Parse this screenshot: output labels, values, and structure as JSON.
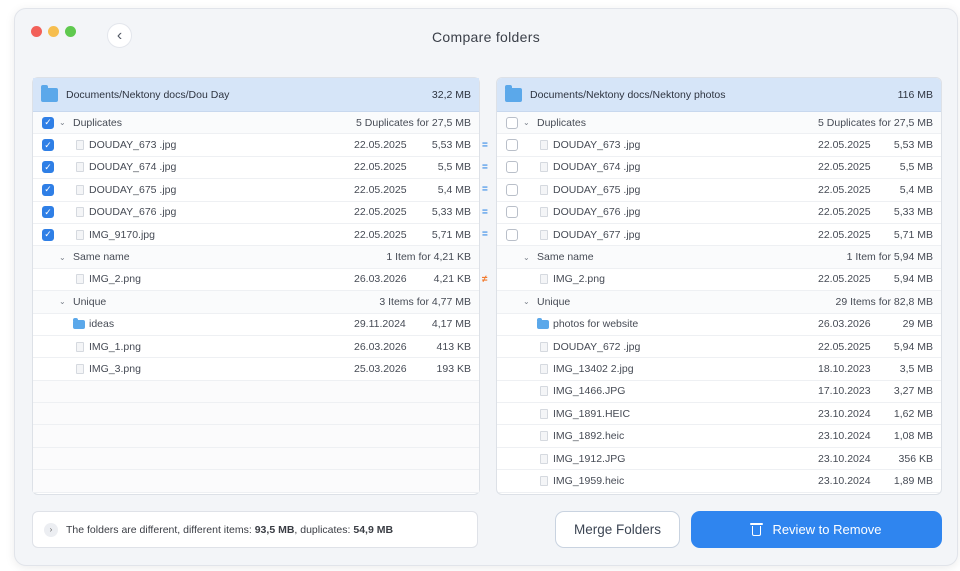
{
  "window": {
    "title": "Compare folders"
  },
  "left": {
    "path": "Documents/Nektony docs/Dou Day",
    "size": "32,2 MB",
    "groups": {
      "duplicates": {
        "label": "Duplicates",
        "summary": "5 Duplicates for 27,5 MB",
        "checked": true
      },
      "same_name": {
        "label": "Same name",
        "summary": "1 Item for 4,21 KB"
      },
      "unique": {
        "label": "Unique",
        "summary": "3 Items for 4,77 MB"
      }
    },
    "duplicates": [
      {
        "name": "DOUDAY_673 .jpg",
        "date": "22.05.2025",
        "size": "5,53 MB",
        "checked": true,
        "mark": "="
      },
      {
        "name": "DOUDAY_674 .jpg",
        "date": "22.05.2025",
        "size": "5,5 MB",
        "checked": true,
        "mark": "="
      },
      {
        "name": "DOUDAY_675 .jpg",
        "date": "22.05.2025",
        "size": "5,4 MB",
        "checked": true,
        "mark": "="
      },
      {
        "name": "DOUDAY_676 .jpg",
        "date": "22.05.2025",
        "size": "5,33 MB",
        "checked": true,
        "mark": "="
      },
      {
        "name": "IMG_9170.jpg",
        "date": "22.05.2025",
        "size": "5,71 MB",
        "checked": true,
        "mark": "="
      }
    ],
    "same_name": [
      {
        "name": "IMG_2.png",
        "date": "26.03.2026",
        "size": "4,21 KB",
        "mark": "≠"
      }
    ],
    "unique": [
      {
        "name": "ideas",
        "date": "29.11.2024",
        "size": "4,17 MB",
        "folder": true
      },
      {
        "name": "IMG_1.png",
        "date": "26.03.2026",
        "size": "413 KB"
      },
      {
        "name": "IMG_3.png",
        "date": "25.03.2026",
        "size": "193 KB"
      }
    ]
  },
  "right": {
    "path": "Documents/Nektony docs/Nektony photos",
    "size": "116 MB",
    "groups": {
      "duplicates": {
        "label": "Duplicates",
        "summary": "5 Duplicates for 27,5 MB",
        "checked": false
      },
      "same_name": {
        "label": "Same name",
        "summary": "1 Item for 5,94 MB"
      },
      "unique": {
        "label": "Unique",
        "summary": "29 Items for 82,8 MB"
      }
    },
    "duplicates": [
      {
        "name": "DOUDAY_673 .jpg",
        "date": "22.05.2025",
        "size": "5,53 MB",
        "checked": false
      },
      {
        "name": "DOUDAY_674 .jpg",
        "date": "22.05.2025",
        "size": "5,5 MB",
        "checked": false
      },
      {
        "name": "DOUDAY_675 .jpg",
        "date": "22.05.2025",
        "size": "5,4 MB",
        "checked": false
      },
      {
        "name": "DOUDAY_676 .jpg",
        "date": "22.05.2025",
        "size": "5,33 MB",
        "checked": false
      },
      {
        "name": "DOUDAY_677 .jpg",
        "date": "22.05.2025",
        "size": "5,71 MB",
        "checked": false
      }
    ],
    "same_name": [
      {
        "name": "IMG_2.png",
        "date": "22.05.2025",
        "size": "5,94 MB"
      }
    ],
    "unique": [
      {
        "name": "photos for website",
        "date": "26.03.2026",
        "size": "29 MB",
        "folder": true
      },
      {
        "name": "DOUDAY_672 .jpg",
        "date": "22.05.2025",
        "size": "5,94 MB"
      },
      {
        "name": "IMG_13402 2.jpg",
        "date": "18.10.2023",
        "size": "3,5 MB"
      },
      {
        "name": "IMG_1466.JPG",
        "date": "17.10.2023",
        "size": "3,27 MB"
      },
      {
        "name": "IMG_1891.HEIC",
        "date": "23.10.2024",
        "size": "1,62 MB"
      },
      {
        "name": "IMG_1892.heic",
        "date": "23.10.2024",
        "size": "1,08 MB"
      },
      {
        "name": "IMG_1912.JPG",
        "date": "23.10.2024",
        "size": "356 KB"
      },
      {
        "name": "IMG_1959.heic",
        "date": "23.10.2024",
        "size": "1,89 MB"
      }
    ]
  },
  "status": {
    "prefix": "The folders are different, different items: ",
    "different": "93,5 MB",
    "middle": ", duplicates: ",
    "duplicates": "54,9 MB"
  },
  "buttons": {
    "merge": "Merge Folders",
    "review": "Review to Remove"
  },
  "icons": {
    "back": "chevron-left-icon",
    "trash": "trash-icon",
    "folder": "folder-icon",
    "file": "file-icon"
  },
  "colors": {
    "accent": "#2f85ef",
    "header": "#d6e5f8",
    "equal_mark": "#3d8fe8",
    "diff_mark": "#f27a2d"
  }
}
